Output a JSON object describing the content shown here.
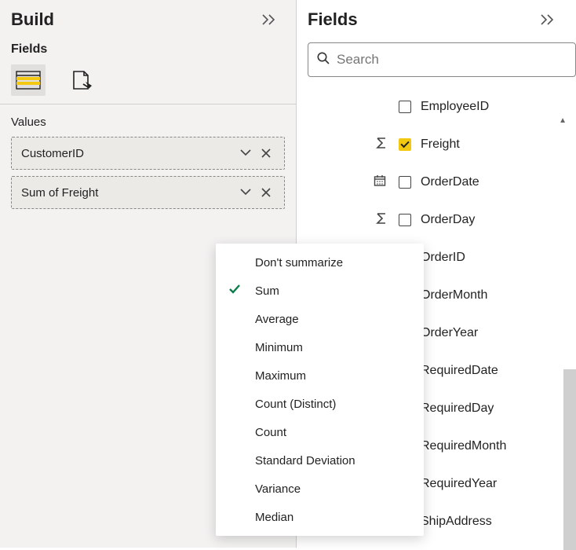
{
  "build": {
    "title": "Build",
    "fields_label": "Fields",
    "values_label": "Values",
    "wells": [
      {
        "label": "CustomerID"
      },
      {
        "label": "Sum of Freight"
      }
    ]
  },
  "fields_pane": {
    "title": "Fields",
    "search_placeholder": "Search",
    "items": [
      {
        "icon": null,
        "checked": false,
        "label": "EmployeeID"
      },
      {
        "icon": "sigma",
        "checked": true,
        "label": "Freight"
      },
      {
        "icon": "cal",
        "checked": false,
        "label": "OrderDate"
      },
      {
        "icon": "sigma",
        "checked": false,
        "label": "OrderDay"
      },
      {
        "icon": null,
        "checked": false,
        "label": "OrderID"
      },
      {
        "icon": null,
        "checked": false,
        "label": "OrderMonth"
      },
      {
        "icon": null,
        "checked": false,
        "label": "OrderYear"
      },
      {
        "icon": null,
        "checked": false,
        "label": "RequiredDate"
      },
      {
        "icon": null,
        "checked": false,
        "label": "RequiredDay"
      },
      {
        "icon": null,
        "checked": false,
        "label": "RequiredMonth"
      },
      {
        "icon": null,
        "checked": false,
        "label": "RequiredYear"
      },
      {
        "icon": null,
        "checked": false,
        "label": "ShipAddress"
      }
    ]
  },
  "context_menu": {
    "selected": "Sum",
    "items": [
      "Don't summarize",
      "Sum",
      "Average",
      "Minimum",
      "Maximum",
      "Count (Distinct)",
      "Count",
      "Standard Deviation",
      "Variance",
      "Median"
    ]
  }
}
